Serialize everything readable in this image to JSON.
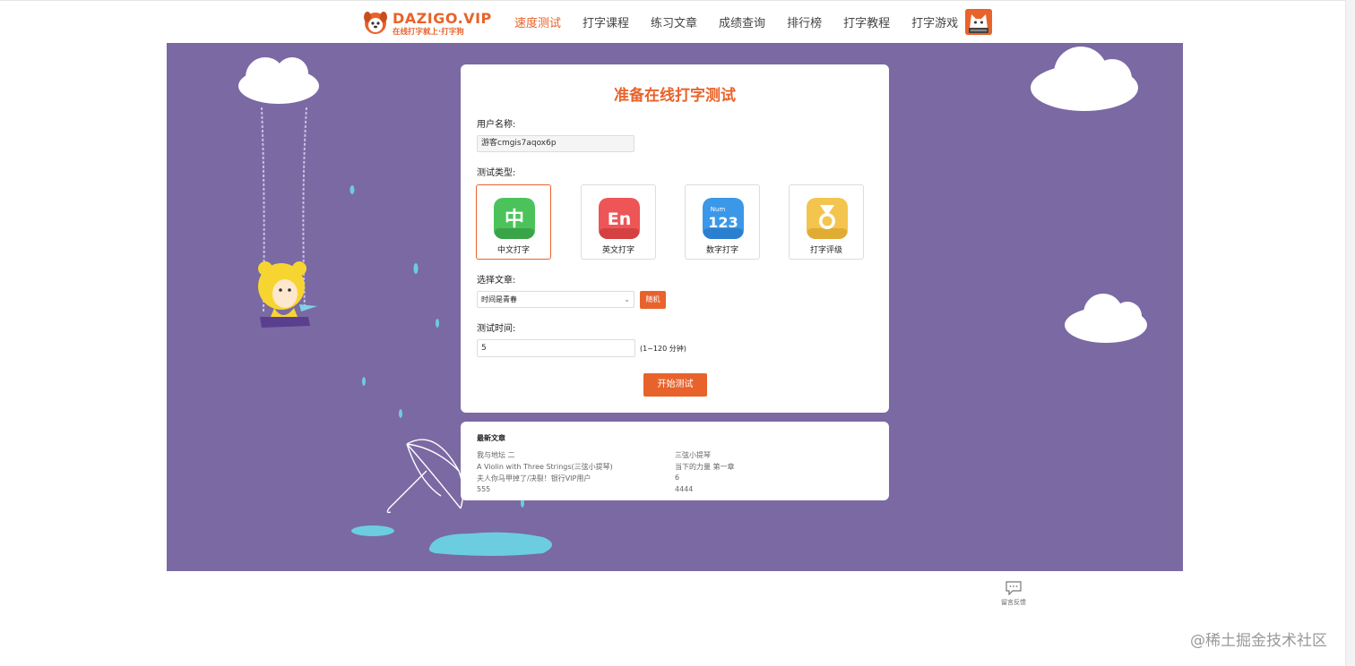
{
  "header": {
    "logo_main": "DAZIGO.VIP",
    "logo_sub": "在线打字就上·打字狗",
    "nav": [
      {
        "label": "速度测试",
        "active": true
      },
      {
        "label": "打字课程",
        "active": false
      },
      {
        "label": "练习文章",
        "active": false
      },
      {
        "label": "成绩查询",
        "active": false
      },
      {
        "label": "排行榜",
        "active": false
      },
      {
        "label": "打字教程",
        "active": false
      },
      {
        "label": "打字游戏",
        "active": false
      }
    ]
  },
  "form": {
    "title": "准备在线打字测试",
    "username_label": "用户名称:",
    "username_value": "游客cmgis7aqox6p",
    "type_label": "测试类型:",
    "types": [
      {
        "label": "中文打字",
        "icon": "chinese-icon",
        "glyph": "中",
        "color": "#4cc35a",
        "selected": true
      },
      {
        "label": "英文打字",
        "icon": "english-icon",
        "glyph": "En",
        "color": "#ee5556",
        "selected": false
      },
      {
        "label": "数字打字",
        "icon": "number-icon",
        "glyph": "123",
        "glyph_small": "Num",
        "color": "#3b98e8",
        "selected": false
      },
      {
        "label": "打字评级",
        "icon": "medal-icon",
        "glyph": "",
        "color": "#f3c54f",
        "selected": false
      }
    ],
    "article_label": "选择文章:",
    "article_selected": "时间是青春",
    "random_label": "随机",
    "time_label": "测试时间:",
    "time_value": "5",
    "time_hint": "(1~120 分钟)",
    "start_label": "开始测试"
  },
  "articles": {
    "title": "最新文章",
    "left": [
      "我与地坛 二",
      "A Violin with Three Strings(三弦小提琴)",
      "夫人你马甲掉了/决裂！银行VIP用户",
      "555"
    ],
    "right": [
      "三弦小提琴",
      "当下的力量 第一章",
      "6",
      "4444"
    ]
  },
  "feedback_label": "留言反馈",
  "watermark": "@稀土掘金技术社区",
  "colors": {
    "accent": "#e8632b",
    "stage_bg": "#7a69a3",
    "puddle": "#6ccde0",
    "mascot": "#f7d531"
  }
}
